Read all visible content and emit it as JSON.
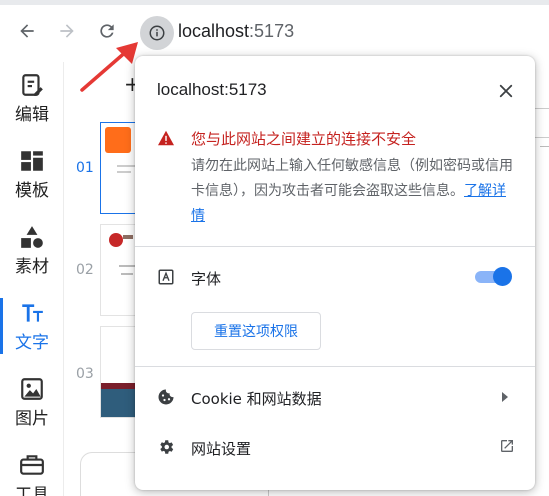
{
  "browser": {
    "url_host": "localhost",
    "url_port": ":5173"
  },
  "sidebar": {
    "items": [
      {
        "label": "编辑",
        "icon": "edit-icon"
      },
      {
        "label": "模板",
        "icon": "template-icon"
      },
      {
        "label": "素材",
        "icon": "shapes-icon"
      },
      {
        "label": "文字",
        "icon": "text-icon",
        "active": true
      },
      {
        "label": "图片",
        "icon": "image-icon"
      },
      {
        "label": "工具",
        "icon": "toolbox-icon"
      }
    ]
  },
  "pages": {
    "add_label": "+",
    "numbers": [
      "01",
      "02",
      "03"
    ]
  },
  "popup": {
    "title": "localhost:5173",
    "warning_title": "您与此网站之间建立的连接不安全",
    "warning_body": "请勿在此网站上输入任何敏感信息（例如密码或信用卡信息），因为攻击者可能会盗取这些信息。",
    "learn_more": "了解详情",
    "font_label": "字体",
    "font_toggle_on": true,
    "reset_button": "重置这项权限",
    "cookies_label": "Cookie 和网站数据",
    "site_settings_label": "网站设置"
  },
  "colors": {
    "accent": "#1a73e8",
    "warning": "#c5221f",
    "annotation_arrow": "#e53935"
  }
}
